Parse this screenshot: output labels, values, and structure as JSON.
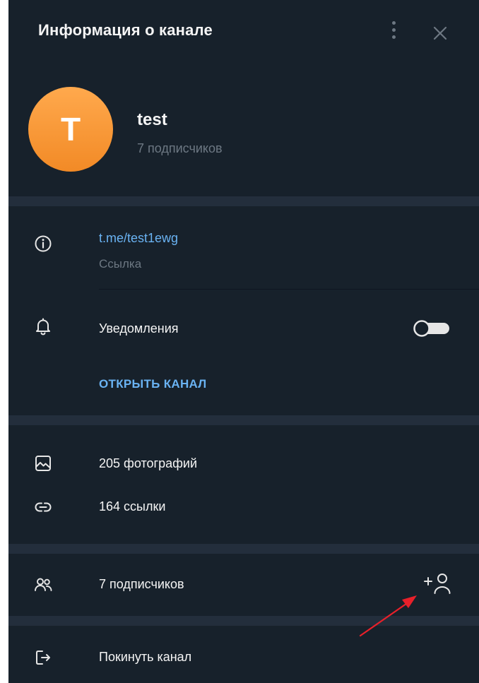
{
  "header": {
    "title": "Информация о канале",
    "menu_icon": "more-vertical-icon",
    "close_icon": "close-icon"
  },
  "channel": {
    "avatar_letter": "T",
    "avatar_color": "#f5902f",
    "name": "test",
    "subscribers": "7 подписчиков"
  },
  "info": {
    "link": "t.me/test1ewg",
    "link_label": "Ссылка",
    "notifications_label": "Уведомления",
    "notifications_on": false,
    "open_channel": "ОТКРЫТЬ КАНАЛ"
  },
  "media": {
    "photos": "205 фотографий",
    "links": "164 ссылки"
  },
  "members": {
    "label": "7 подписчиков",
    "add_icon": "add-user-icon"
  },
  "actions": {
    "leave": "Покинуть канал"
  },
  "colors": {
    "background": "#17212b",
    "separator": "#232e3c",
    "accent": "#6ab3f3",
    "secondary_text": "#6d7883",
    "annotation_arrow": "#e8202a"
  }
}
